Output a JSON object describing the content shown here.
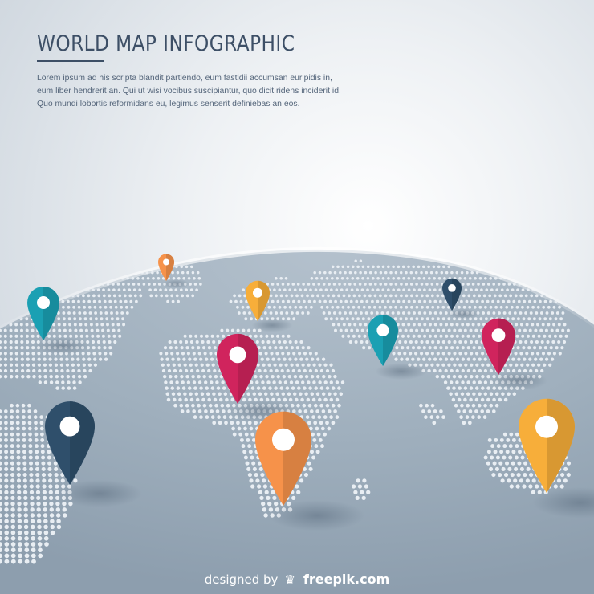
{
  "header": {
    "title": "WORLD MAP INFOGRAPHIC",
    "description": "Lorem ipsum ad his scripta blandit partiendo, eum fastidii accumsan euripidis in, eum liber hendrerit an. Qui ut wisi vocibus suscipiantur, quo dicit ridens inciderit id. Quo mundi lobortis reformidans eu, legimus senserit definiebas an eos."
  },
  "colors": {
    "teal": "#1ba0b3",
    "navy": "#2f4f6b",
    "crimson": "#d0245d",
    "orange": "#f6924a",
    "amber": "#f7ae3a",
    "globe": "#a2b1bf",
    "dots": "#e9eef3",
    "title": "#3d4f66"
  },
  "pins": [
    {
      "id": "north-america-west",
      "color": "teal",
      "icon": "map-pin-icon"
    },
    {
      "id": "greenland",
      "color": "orange",
      "icon": "map-pin-icon"
    },
    {
      "id": "scandinavia",
      "color": "amber",
      "icon": "map-pin-icon"
    },
    {
      "id": "northeast-asia",
      "color": "navy",
      "icon": "map-pin-icon"
    },
    {
      "id": "central-asia",
      "color": "teal",
      "icon": "map-pin-icon"
    },
    {
      "id": "east-asia",
      "color": "crimson",
      "icon": "map-pin-icon"
    },
    {
      "id": "north-africa",
      "color": "crimson",
      "icon": "map-pin-icon"
    },
    {
      "id": "south-america",
      "color": "navy",
      "icon": "map-pin-icon"
    },
    {
      "id": "southern-africa",
      "color": "orange",
      "icon": "map-pin-icon"
    },
    {
      "id": "australia",
      "color": "amber",
      "icon": "map-pin-icon"
    }
  ],
  "footer": {
    "designed_by": "designed by",
    "logo_icon": "freepik-logo-icon",
    "brand": "freepik.com"
  }
}
